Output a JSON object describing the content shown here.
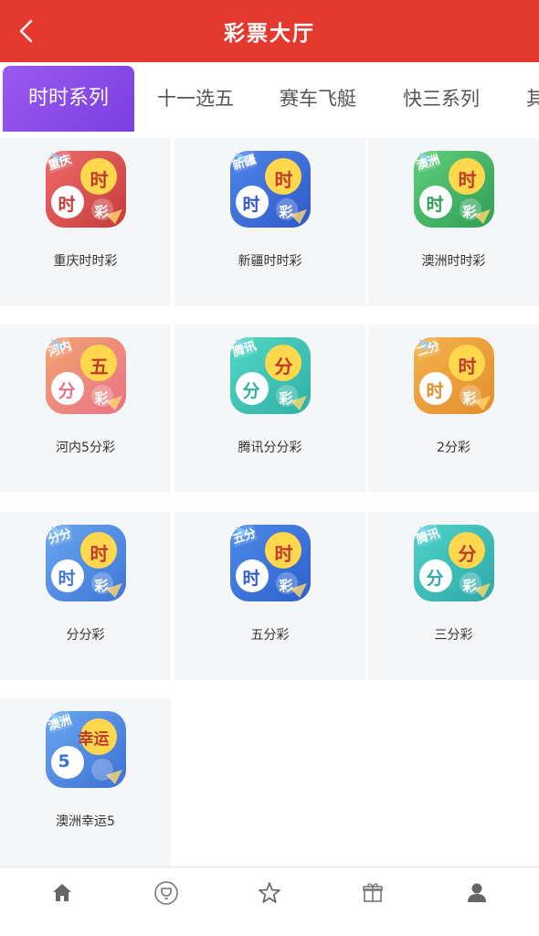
{
  "header": {
    "title": "彩票大厅"
  },
  "tabs": [
    "时时系列",
    "十一选五",
    "赛车飞艇",
    "快三系列",
    "其"
  ],
  "games": [
    {
      "name": "重庆时时彩",
      "badge": "重庆",
      "b1": "时",
      "b2": "时",
      "b3": "彩",
      "bg": "#ef6b6b",
      "bg2": "#c63b3b"
    },
    {
      "name": "新疆时时彩",
      "badge": "新疆",
      "b1": "时",
      "b2": "时",
      "b3": "彩",
      "bg": "#4f86e8",
      "bg2": "#2f59c9"
    },
    {
      "name": "澳洲时时彩",
      "badge": "澳洲",
      "b1": "时",
      "b2": "时",
      "b3": "彩",
      "bg": "#5fd07b",
      "bg2": "#2f9d56"
    },
    {
      "name": "河内5分彩",
      "badge": "河内",
      "b1": "五",
      "b2": "分",
      "b3": "彩",
      "bg": "#f1a56e",
      "bg2": "#e8728a"
    },
    {
      "name": "腾讯分分彩",
      "badge": "腾讯",
      "b1": "分",
      "b2": "分",
      "b3": "彩",
      "bg": "#53d7c4",
      "bg2": "#2fb0a5"
    },
    {
      "name": "2分彩",
      "badge": "二分",
      "b1": "时",
      "b2": "时",
      "b3": "彩",
      "bg": "#f3b34b",
      "bg2": "#e38d2d"
    },
    {
      "name": "分分彩",
      "badge": "分分",
      "b1": "时",
      "b2": "时",
      "b3": "彩",
      "bg": "#6aa6f0",
      "bg2": "#3f75d6"
    },
    {
      "name": "五分彩",
      "badge": "五分",
      "b1": "时",
      "b2": "时",
      "b3": "彩",
      "bg": "#4d8be9",
      "bg2": "#2e5fcc"
    },
    {
      "name": "三分彩",
      "badge": "腾讯",
      "b1": "分",
      "b2": "分",
      "b3": "彩",
      "bg": "#4fd3c9",
      "bg2": "#2ea8a8"
    },
    {
      "name": "澳洲幸运5",
      "badge": "澳洲",
      "b1": "幸运",
      "b2": "5",
      "b3": "",
      "bg": "#6aa8ef",
      "bg2": "#3d6fd4"
    }
  ],
  "footer_icons": [
    "home-icon",
    "trophy-icon",
    "star-icon",
    "gift-icon",
    "user-icon"
  ]
}
